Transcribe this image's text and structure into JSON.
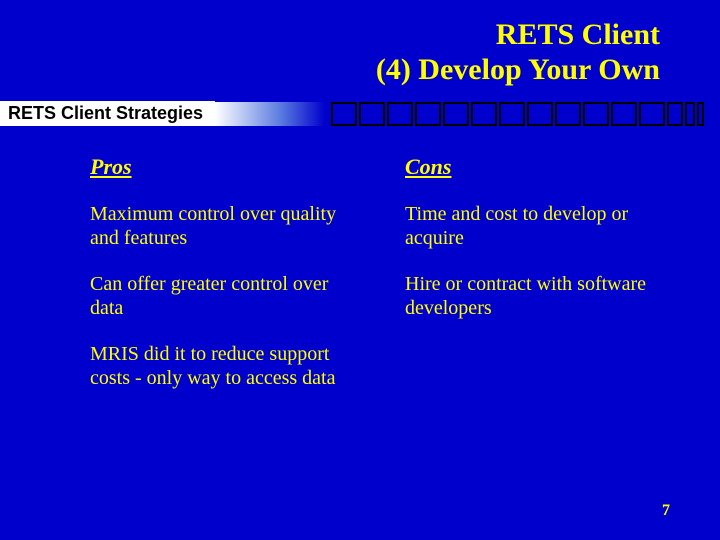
{
  "title": {
    "line1": "RETS Client",
    "line2": "(4) Develop Your Own"
  },
  "subtitle": "RETS Client Strategies",
  "columns": {
    "left": {
      "header": "Pros",
      "items": [
        "Maximum control over quality and features",
        "Can offer greater control over data",
        "MRIS did it to reduce support costs - only way to access data"
      ]
    },
    "right": {
      "header": "Cons",
      "items": [
        "Time and cost to develop or acquire",
        "Hire or contract with software developers"
      ]
    }
  },
  "page_number": "7"
}
